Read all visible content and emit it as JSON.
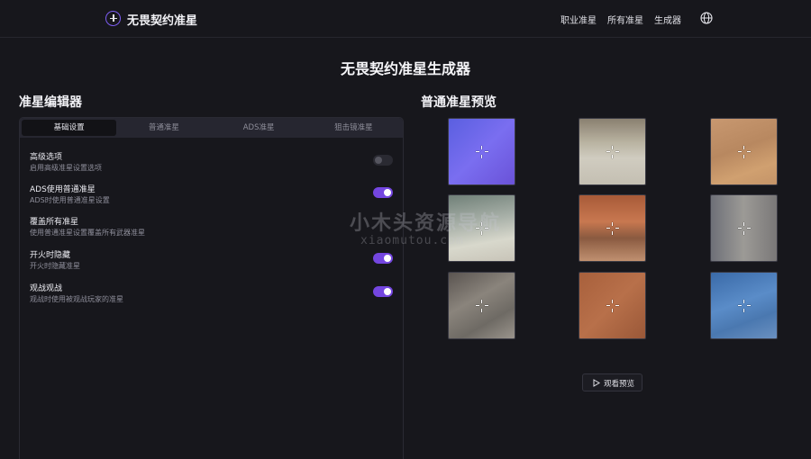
{
  "header": {
    "brand": "无畏契约准星",
    "nav": [
      "职业准星",
      "所有准星",
      "生成器"
    ],
    "icons": {
      "logo": "crosshair-plus-icon",
      "language": "globe-icon"
    }
  },
  "page_title": "无畏契约准星生成器",
  "editor": {
    "title": "准星编辑器",
    "tabs": [
      "基础设置",
      "普通准星",
      "ADS准星",
      "狙击镜准星"
    ],
    "active_tab": "基础设置",
    "options": [
      {
        "title": "高级选项",
        "desc": "启用高级准星设置选项",
        "enabled": false
      },
      {
        "title": "ADS使用普通准星",
        "desc": "ADS时使用普通准星设置",
        "enabled": true
      },
      {
        "title": "覆盖所有准星",
        "desc": "使用普通准星设置覆盖所有武器准星",
        "enabled": null
      },
      {
        "title": "开火时隐藏",
        "desc": "开火时隐藏准星",
        "enabled": true
      },
      {
        "title": "观战观战",
        "desc": "观战时使用被观战玩家的准星",
        "enabled": true
      }
    ]
  },
  "preview": {
    "title": "普通准星预览",
    "thumbnails": [
      "purple-gradient",
      "plaza-scene",
      "sand-wall-scene",
      "interior-scene",
      "orange-doorway-scene",
      "wall-corner-scene",
      "metal-floor-scene",
      "orange-plaster-scene",
      "blue-container-scene"
    ],
    "watch_button": "观看预览",
    "watch_icon": "play-icon"
  },
  "watermark": {
    "text": "小木头资源导航",
    "sub": "xiaomutou.com"
  },
  "colors": {
    "accent": "#7446e0",
    "background": "#17171c"
  }
}
